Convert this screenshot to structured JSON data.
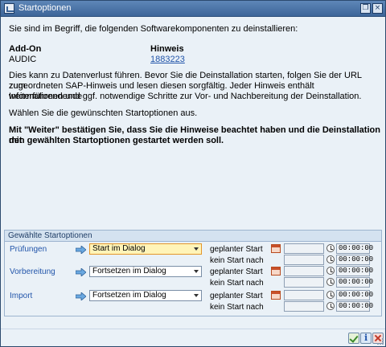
{
  "window": {
    "title": "Startoptionen"
  },
  "intro": "Sie sind im Begriff, die folgenden Softwarekomponenten zu deinstallieren:",
  "table": {
    "col_addon": "Add-On",
    "col_hint": "Hinweis",
    "addon": "AUDIC",
    "hint": "1883223"
  },
  "para1_l1": "Dies kann zu Datenverlust führen. Bevor Sie die Deinstallation starten, folgen Sie der URL zum",
  "para1_l2": "zugeordneten SAP-Hinweis und lesen diesen sorgfältig. Jeder Hinweis enthält weiterführendende",
  "para1_l3": "Informationen und ggf. notwendige Schritte zur Vor- und Nachbereitung der Deinstallation.",
  "para2": "Wählen Sie die gewünschten Startoptionen aus.",
  "para3_l1": "Mit \"Weiter\" bestätigen Sie, dass Sie die Hinweise beachtet haben und die Deinstallation mit",
  "para3_l2": "den gewählten Startoptionen gestartet werden soll.",
  "group": {
    "title": "Gewählte Startoptionen",
    "rows": [
      {
        "label": "Prüfungen",
        "value": "Start im Dialog",
        "start": "geplanter Start",
        "nostart": "kein Start nach",
        "time1": "00:00:00",
        "time2": "00:00:00"
      },
      {
        "label": "Vorbereitung",
        "value": "Fortsetzen im Dialog",
        "start": "geplanter Start",
        "nostart": "kein Start nach",
        "time1": "00:00:00",
        "time2": "00:00:00"
      },
      {
        "label": "Import",
        "value": "Fortsetzen im Dialog",
        "start": "geplanter Start",
        "nostart": "kein Start nach",
        "time1": "00:00:00",
        "time2": "00:00:00"
      }
    ]
  },
  "buttons": {
    "close": "×",
    "restore": "❐"
  },
  "colors": {
    "accent": "#3d6599",
    "link": "#2255aa",
    "active_field": "#fff4b8"
  }
}
